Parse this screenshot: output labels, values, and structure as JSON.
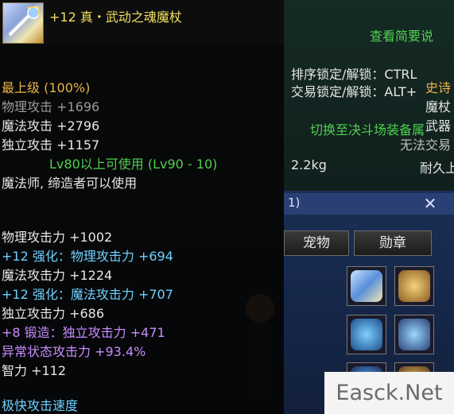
{
  "item": {
    "title": "+12 真・武动之魂魔杖",
    "icon": "staff-item-icon"
  },
  "right_panel": {
    "view_summary": "查看简要说",
    "sort_lock": "排序锁定/解锁：CTRL",
    "trade_lock": "交易锁定/解锁：ALT+",
    "switch_duel": "切换至决斗场装备属",
    "weight": "2.2kg",
    "durability_label": "耐久上"
  },
  "stats": {
    "grade": "最上级 (100%)",
    "rarity": "史诗",
    "phys_attack": "物理攻击 +1696",
    "type_staff": "魔杖",
    "mag_attack": "魔法攻击 +2796",
    "type_weapon": "武器",
    "indep_attack": "独立攻击 +1157",
    "untradable": "无法交易",
    "level_req": "Lv80以上可使用 (Lv90 - 10)",
    "class_req": "魔法师, 缔造者可以使用",
    "phys_power": "物理攻击力 +1002",
    "enh_phys": "+12 强化：物理攻击力 +694",
    "mag_power": "魔法攻击力 +1224",
    "enh_mag": "+12 强化：魔法攻击力 +707",
    "indep_power": "独立攻击力 +686",
    "forge_indep": "+8 锻造：独立攻击力 +471",
    "abnormal": "异常状态攻击力 +93.4%",
    "intellect": "智力 +112",
    "speed": "极快攻击速度"
  },
  "equip": {
    "bar_text": "1)",
    "tab_pet": "宠物",
    "tab_medal": "勋章"
  },
  "watermark": "Easck.Net"
}
